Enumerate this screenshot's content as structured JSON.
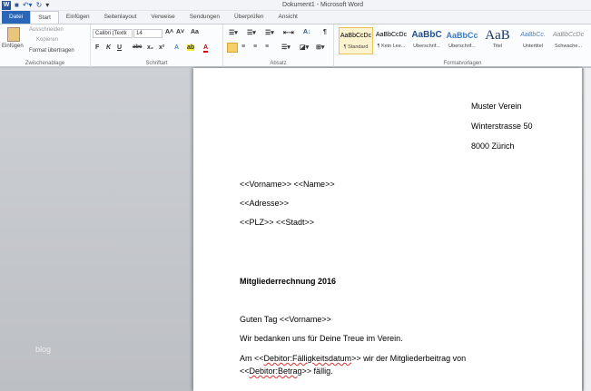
{
  "window": {
    "title": "Dokument1 - Microsoft Word",
    "logo": "W"
  },
  "qat": [
    "save-icon",
    "undo-icon",
    "redo-icon",
    "customize-icon"
  ],
  "tabs": [
    "Datei",
    "Start",
    "Einfügen",
    "Seitenlayout",
    "Verweise",
    "Sendungen",
    "Überprüfen",
    "Ansicht"
  ],
  "clipboard": {
    "paste": "Einfügen",
    "cut": "Ausschneiden",
    "copy": "Kopieren",
    "format_painter": "Format übertragen",
    "label": "Zwischenablage"
  },
  "font": {
    "name": "Calibri (Textk",
    "size": "14",
    "label": "Schriftart",
    "bold": "F",
    "italic": "K",
    "underline": "U",
    "strike": "abc",
    "sub": "x₂",
    "sup": "x²",
    "grow": "A˄",
    "shrink": "A˅",
    "case": "Aa"
  },
  "paragraph": {
    "label": "Absatz",
    "pilcrow": "¶",
    "sort": "A↓"
  },
  "styles": {
    "label": "Formatvorlagen",
    "items": [
      {
        "preview": "AaBbCcDc",
        "name": "¶ Standard"
      },
      {
        "preview": "AaBbCcDc",
        "name": "¶ Kein Lee..."
      },
      {
        "preview": "AaBbC",
        "name": "Überschrif..."
      },
      {
        "preview": "AaBbCc",
        "name": "Überschrif..."
      },
      {
        "preview": "AaB",
        "name": "Titel"
      },
      {
        "preview": "AaBbCc.",
        "name": "Untertitel"
      },
      {
        "preview": "AaBbCcDc",
        "name": "Schwache..."
      }
    ]
  },
  "document": {
    "sender": [
      "Muster Verein",
      "Winterstrasse 50",
      "8000 Zürich"
    ],
    "recipient": [
      "<<Vorname>> <<Name>>",
      "<<Adresse>>",
      "<<PLZ>> <<Stadt>>"
    ],
    "subject": "Mitgliederrechnung 2016",
    "greeting": "Guten Tag <<Vorname>>",
    "line1": "Wir bedanken uns für Deine Treue im Verein.",
    "line2_pre": "Am <<",
    "line2_field": "Debitor:Fälligkeitsdatum",
    "line2_post": ">> wir der Mitgliederbeitrag von",
    "line3_pre": "<<",
    "line3_field": "Debitor:Betrag",
    "line3_post": ">> fällig."
  },
  "watermark": "blog"
}
